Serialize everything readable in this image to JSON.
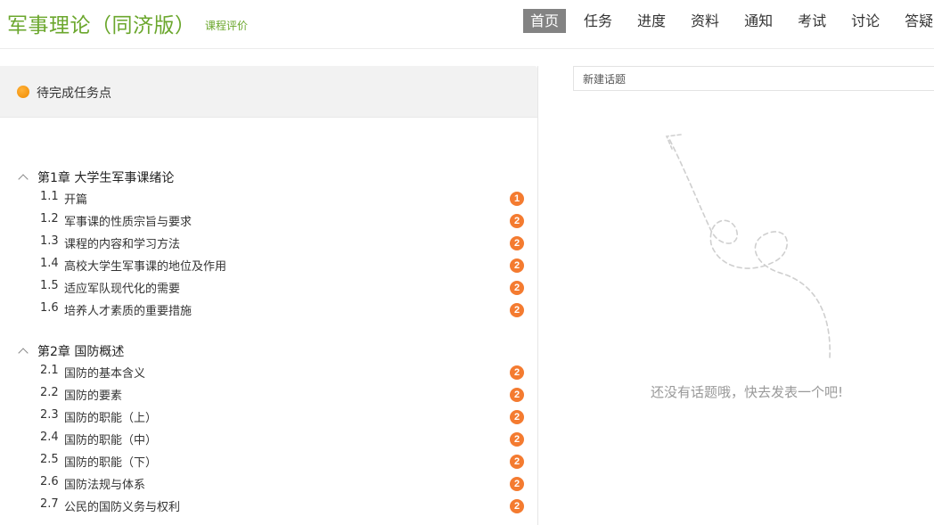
{
  "header": {
    "course_title": "军事理论（同济版）",
    "course_review": "课程评价",
    "nav": [
      "首页",
      "任务",
      "进度",
      "资料",
      "通知",
      "考试",
      "讨论",
      "答疑"
    ],
    "active_nav": "首页"
  },
  "pending": {
    "label": "待完成任务点"
  },
  "chapters": [
    {
      "title": "第1章 大学生军事课绪论",
      "sections": [
        {
          "num": "1.1",
          "title": "开篇",
          "badge": "1"
        },
        {
          "num": "1.2",
          "title": "军事课的性质宗旨与要求",
          "badge": "2"
        },
        {
          "num": "1.3",
          "title": "课程的内容和学习方法",
          "badge": "2"
        },
        {
          "num": "1.4",
          "title": "高校大学生军事课的地位及作用",
          "badge": "2"
        },
        {
          "num": "1.5",
          "title": "适应军队现代化的需要",
          "badge": "2"
        },
        {
          "num": "1.6",
          "title": "培养人才素质的重要措施",
          "badge": "2"
        }
      ]
    },
    {
      "title": "第2章 国防概述",
      "sections": [
        {
          "num": "2.1",
          "title": "国防的基本含义",
          "badge": "2"
        },
        {
          "num": "2.2",
          "title": "国防的要素",
          "badge": "2"
        },
        {
          "num": "2.3",
          "title": "国防的职能（上）",
          "badge": "2"
        },
        {
          "num": "2.4",
          "title": "国防的职能（中）",
          "badge": "2"
        },
        {
          "num": "2.5",
          "title": "国防的职能（下）",
          "badge": "2"
        },
        {
          "num": "2.6",
          "title": "国防法规与体系",
          "badge": "2"
        },
        {
          "num": "2.7",
          "title": "公民的国防义务与权利",
          "badge": "2"
        }
      ]
    }
  ],
  "discussion": {
    "new_topic_label": "新建话题",
    "empty_message": "还没有话题哦，快去发表一个吧!"
  },
  "colors": {
    "brand_green": "#6ba72d",
    "badge_orange": "#f47b30",
    "nav_active_bg": "#838383",
    "pending_dot": "#f08a00"
  }
}
